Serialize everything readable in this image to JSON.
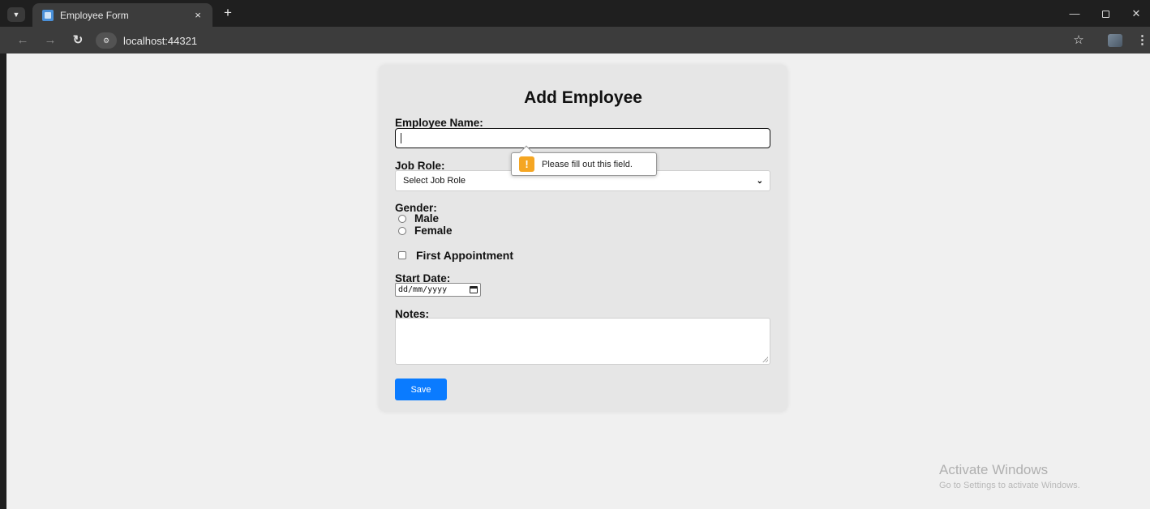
{
  "browser": {
    "tab_title": "Employee Form",
    "tab_close": "×",
    "new_tab": "+",
    "url": "localhost:44321"
  },
  "form": {
    "title": "Add Employee",
    "employee_name_label": "Employee Name:",
    "employee_name_value": "",
    "validation_message": "Please fill out this field.",
    "job_role_label": "Job Role:",
    "job_role_selected": "Select Job Role",
    "gender_label": "Gender:",
    "gender_options": [
      "Male",
      "Female"
    ],
    "first_appointment_label": "First Appointment",
    "start_date_label": "Start Date:",
    "start_date_placeholder": "dd/mm/yyyy",
    "notes_label": "Notes:",
    "save_label": "Save"
  },
  "watermark": {
    "title": "Activate Windows",
    "subtitle": "Go to Settings to activate Windows."
  },
  "colors": {
    "accent": "#0a7bff",
    "warning": "#f5a623",
    "card_background": "#e6e6e6",
    "page_background": "#f0f0f0"
  }
}
